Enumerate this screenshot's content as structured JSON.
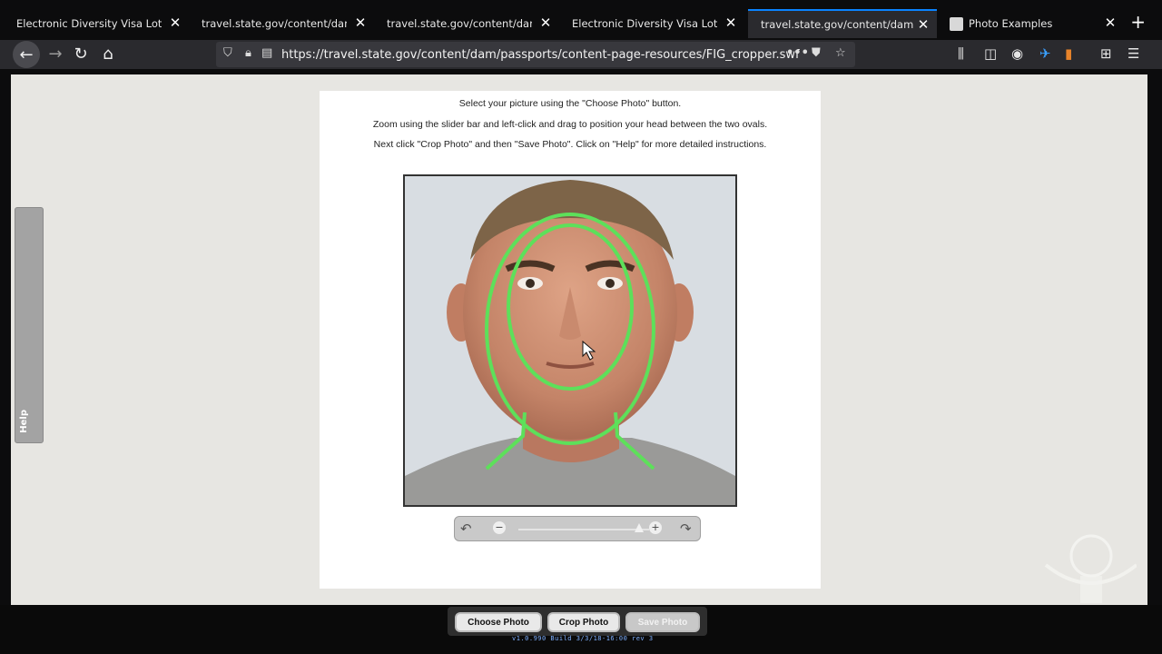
{
  "browser": {
    "tabs": [
      {
        "label": "Electronic Diversity Visa Lottery",
        "active": false
      },
      {
        "label": "travel.state.gov/content/dam/pas",
        "active": false
      },
      {
        "label": "travel.state.gov/content/dam/pas",
        "active": false
      },
      {
        "label": "Electronic Diversity Visa Lottery",
        "active": false
      },
      {
        "label": "travel.state.gov/content/dam/passp",
        "active": true
      },
      {
        "label": "Photo Examples",
        "active": false
      }
    ],
    "url": "https://travel.state.gov/content/dam/passports/content-page-resources/FIG_cropper.swf"
  },
  "page": {
    "instructions": [
      "Select your picture using the \"Choose Photo\" button.",
      "Zoom using the slider bar and left-click and drag to position your head between the two ovals.",
      "Next click \"Crop Photo\" and then \"Save Photo\".  Click on \"Help\" for more detailed instructions."
    ],
    "help_label": "Help",
    "slider": {
      "minus": "−",
      "plus": "+",
      "zoom_level": 0.95
    }
  },
  "buttons": {
    "choose": "Choose Photo",
    "crop": "Crop Photo",
    "save": "Save Photo"
  },
  "version": "v1.0.990 Build 3/3/18-16:00 rev 3",
  "colors": {
    "tab_accent": "#0a84ff",
    "oval_green": "#5de05a",
    "page_bg": "#e7e6e2"
  }
}
